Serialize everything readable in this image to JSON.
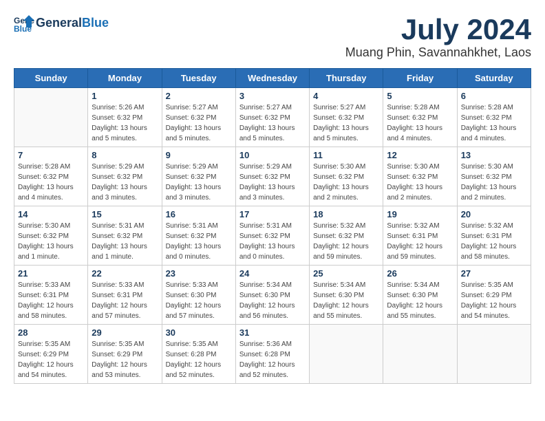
{
  "header": {
    "logo_general": "General",
    "logo_blue": "Blue",
    "title": "July 2024",
    "location": "Muang Phin, Savannahkhet, Laos"
  },
  "columns": [
    "Sunday",
    "Monday",
    "Tuesday",
    "Wednesday",
    "Thursday",
    "Friday",
    "Saturday"
  ],
  "weeks": [
    [
      {
        "day": "",
        "sunrise": "",
        "sunset": "",
        "daylight": ""
      },
      {
        "day": "1",
        "sunrise": "Sunrise: 5:26 AM",
        "sunset": "Sunset: 6:32 PM",
        "daylight": "Daylight: 13 hours and 5 minutes."
      },
      {
        "day": "2",
        "sunrise": "Sunrise: 5:27 AM",
        "sunset": "Sunset: 6:32 PM",
        "daylight": "Daylight: 13 hours and 5 minutes."
      },
      {
        "day": "3",
        "sunrise": "Sunrise: 5:27 AM",
        "sunset": "Sunset: 6:32 PM",
        "daylight": "Daylight: 13 hours and 5 minutes."
      },
      {
        "day": "4",
        "sunrise": "Sunrise: 5:27 AM",
        "sunset": "Sunset: 6:32 PM",
        "daylight": "Daylight: 13 hours and 5 minutes."
      },
      {
        "day": "5",
        "sunrise": "Sunrise: 5:28 AM",
        "sunset": "Sunset: 6:32 PM",
        "daylight": "Daylight: 13 hours and 4 minutes."
      },
      {
        "day": "6",
        "sunrise": "Sunrise: 5:28 AM",
        "sunset": "Sunset: 6:32 PM",
        "daylight": "Daylight: 13 hours and 4 minutes."
      }
    ],
    [
      {
        "day": "7",
        "sunrise": "Sunrise: 5:28 AM",
        "sunset": "Sunset: 6:32 PM",
        "daylight": "Daylight: 13 hours and 4 minutes."
      },
      {
        "day": "8",
        "sunrise": "Sunrise: 5:29 AM",
        "sunset": "Sunset: 6:32 PM",
        "daylight": "Daylight: 13 hours and 3 minutes."
      },
      {
        "day": "9",
        "sunrise": "Sunrise: 5:29 AM",
        "sunset": "Sunset: 6:32 PM",
        "daylight": "Daylight: 13 hours and 3 minutes."
      },
      {
        "day": "10",
        "sunrise": "Sunrise: 5:29 AM",
        "sunset": "Sunset: 6:32 PM",
        "daylight": "Daylight: 13 hours and 3 minutes."
      },
      {
        "day": "11",
        "sunrise": "Sunrise: 5:30 AM",
        "sunset": "Sunset: 6:32 PM",
        "daylight": "Daylight: 13 hours and 2 minutes."
      },
      {
        "day": "12",
        "sunrise": "Sunrise: 5:30 AM",
        "sunset": "Sunset: 6:32 PM",
        "daylight": "Daylight: 13 hours and 2 minutes."
      },
      {
        "day": "13",
        "sunrise": "Sunrise: 5:30 AM",
        "sunset": "Sunset: 6:32 PM",
        "daylight": "Daylight: 13 hours and 2 minutes."
      }
    ],
    [
      {
        "day": "14",
        "sunrise": "Sunrise: 5:30 AM",
        "sunset": "Sunset: 6:32 PM",
        "daylight": "Daylight: 13 hours and 1 minute."
      },
      {
        "day": "15",
        "sunrise": "Sunrise: 5:31 AM",
        "sunset": "Sunset: 6:32 PM",
        "daylight": "Daylight: 13 hours and 1 minute."
      },
      {
        "day": "16",
        "sunrise": "Sunrise: 5:31 AM",
        "sunset": "Sunset: 6:32 PM",
        "daylight": "Daylight: 13 hours and 0 minutes."
      },
      {
        "day": "17",
        "sunrise": "Sunrise: 5:31 AM",
        "sunset": "Sunset: 6:32 PM",
        "daylight": "Daylight: 13 hours and 0 minutes."
      },
      {
        "day": "18",
        "sunrise": "Sunrise: 5:32 AM",
        "sunset": "Sunset: 6:32 PM",
        "daylight": "Daylight: 12 hours and 59 minutes."
      },
      {
        "day": "19",
        "sunrise": "Sunrise: 5:32 AM",
        "sunset": "Sunset: 6:31 PM",
        "daylight": "Daylight: 12 hours and 59 minutes."
      },
      {
        "day": "20",
        "sunrise": "Sunrise: 5:32 AM",
        "sunset": "Sunset: 6:31 PM",
        "daylight": "Daylight: 12 hours and 58 minutes."
      }
    ],
    [
      {
        "day": "21",
        "sunrise": "Sunrise: 5:33 AM",
        "sunset": "Sunset: 6:31 PM",
        "daylight": "Daylight: 12 hours and 58 minutes."
      },
      {
        "day": "22",
        "sunrise": "Sunrise: 5:33 AM",
        "sunset": "Sunset: 6:31 PM",
        "daylight": "Daylight: 12 hours and 57 minutes."
      },
      {
        "day": "23",
        "sunrise": "Sunrise: 5:33 AM",
        "sunset": "Sunset: 6:30 PM",
        "daylight": "Daylight: 12 hours and 57 minutes."
      },
      {
        "day": "24",
        "sunrise": "Sunrise: 5:34 AM",
        "sunset": "Sunset: 6:30 PM",
        "daylight": "Daylight: 12 hours and 56 minutes."
      },
      {
        "day": "25",
        "sunrise": "Sunrise: 5:34 AM",
        "sunset": "Sunset: 6:30 PM",
        "daylight": "Daylight: 12 hours and 55 minutes."
      },
      {
        "day": "26",
        "sunrise": "Sunrise: 5:34 AM",
        "sunset": "Sunset: 6:30 PM",
        "daylight": "Daylight: 12 hours and 55 minutes."
      },
      {
        "day": "27",
        "sunrise": "Sunrise: 5:35 AM",
        "sunset": "Sunset: 6:29 PM",
        "daylight": "Daylight: 12 hours and 54 minutes."
      }
    ],
    [
      {
        "day": "28",
        "sunrise": "Sunrise: 5:35 AM",
        "sunset": "Sunset: 6:29 PM",
        "daylight": "Daylight: 12 hours and 54 minutes."
      },
      {
        "day": "29",
        "sunrise": "Sunrise: 5:35 AM",
        "sunset": "Sunset: 6:29 PM",
        "daylight": "Daylight: 12 hours and 53 minutes."
      },
      {
        "day": "30",
        "sunrise": "Sunrise: 5:35 AM",
        "sunset": "Sunset: 6:28 PM",
        "daylight": "Daylight: 12 hours and 52 minutes."
      },
      {
        "day": "31",
        "sunrise": "Sunrise: 5:36 AM",
        "sunset": "Sunset: 6:28 PM",
        "daylight": "Daylight: 12 hours and 52 minutes."
      },
      {
        "day": "",
        "sunrise": "",
        "sunset": "",
        "daylight": ""
      },
      {
        "day": "",
        "sunrise": "",
        "sunset": "",
        "daylight": ""
      },
      {
        "day": "",
        "sunrise": "",
        "sunset": "",
        "daylight": ""
      }
    ]
  ]
}
